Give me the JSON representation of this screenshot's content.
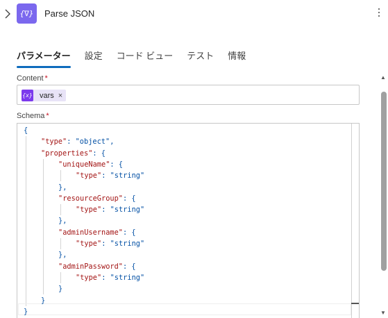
{
  "header": {
    "title": "Parse JSON",
    "action_icon": "{∇}",
    "expand_icon": "chevron-right-icon",
    "menu_icon": "more-vertical-icon"
  },
  "tabs": [
    {
      "label": "パラメーター",
      "active": true
    },
    {
      "label": "設定",
      "active": false
    },
    {
      "label": "コード ビュー",
      "active": false
    },
    {
      "label": "テスト",
      "active": false
    },
    {
      "label": "情報",
      "active": false
    }
  ],
  "content": {
    "label": "Content",
    "required_mark": "*",
    "token": {
      "icon": "{x}",
      "label": "vars",
      "remove": "×"
    }
  },
  "schema": {
    "label": "Schema",
    "required_mark": "*",
    "lines": [
      {
        "indent": 0,
        "parts": [
          {
            "t": "{",
            "c": "p"
          }
        ]
      },
      {
        "indent": 1,
        "parts": [
          {
            "t": "\"type\"",
            "c": "k"
          },
          {
            "t": ": ",
            "c": "p"
          },
          {
            "t": "\"object\"",
            "c": "v"
          },
          {
            "t": ",",
            "c": "p"
          }
        ]
      },
      {
        "indent": 1,
        "parts": [
          {
            "t": "\"properties\"",
            "c": "k"
          },
          {
            "t": ": {",
            "c": "p"
          }
        ]
      },
      {
        "indent": 2,
        "parts": [
          {
            "t": "\"uniqueName\"",
            "c": "k"
          },
          {
            "t": ": {",
            "c": "p"
          }
        ]
      },
      {
        "indent": 3,
        "parts": [
          {
            "t": "\"type\"",
            "c": "k"
          },
          {
            "t": ": ",
            "c": "p"
          },
          {
            "t": "\"string\"",
            "c": "v"
          }
        ]
      },
      {
        "indent": 2,
        "parts": [
          {
            "t": "},",
            "c": "p"
          }
        ]
      },
      {
        "indent": 2,
        "parts": [
          {
            "t": "\"resourceGroup\"",
            "c": "k"
          },
          {
            "t": ": {",
            "c": "p"
          }
        ]
      },
      {
        "indent": 3,
        "parts": [
          {
            "t": "\"type\"",
            "c": "k"
          },
          {
            "t": ": ",
            "c": "p"
          },
          {
            "t": "\"string\"",
            "c": "v"
          }
        ]
      },
      {
        "indent": 2,
        "parts": [
          {
            "t": "},",
            "c": "p"
          }
        ]
      },
      {
        "indent": 2,
        "parts": [
          {
            "t": "\"adminUsername\"",
            "c": "k"
          },
          {
            "t": ": {",
            "c": "p"
          }
        ]
      },
      {
        "indent": 3,
        "parts": [
          {
            "t": "\"type\"",
            "c": "k"
          },
          {
            "t": ": ",
            "c": "p"
          },
          {
            "t": "\"string\"",
            "c": "v"
          }
        ]
      },
      {
        "indent": 2,
        "parts": [
          {
            "t": "},",
            "c": "p"
          }
        ]
      },
      {
        "indent": 2,
        "parts": [
          {
            "t": "\"adminPassword\"",
            "c": "k"
          },
          {
            "t": ": {",
            "c": "p"
          }
        ]
      },
      {
        "indent": 3,
        "parts": [
          {
            "t": "\"type\"",
            "c": "k"
          },
          {
            "t": ": ",
            "c": "p"
          },
          {
            "t": "\"string\"",
            "c": "v"
          }
        ]
      },
      {
        "indent": 2,
        "parts": [
          {
            "t": "}",
            "c": "p"
          }
        ]
      },
      {
        "indent": 1,
        "parts": [
          {
            "t": "}",
            "c": "p"
          }
        ]
      },
      {
        "indent": 0,
        "parts": [
          {
            "t": "}",
            "c": "p"
          }
        ]
      }
    ]
  },
  "colors": {
    "accent": "#0f6cbd",
    "action_icon_bg": "#7b68ee",
    "token_icon_bg": "#7c3aed",
    "json_key": "#a31515",
    "json_value": "#0451a5",
    "required": "#c50f1f"
  }
}
